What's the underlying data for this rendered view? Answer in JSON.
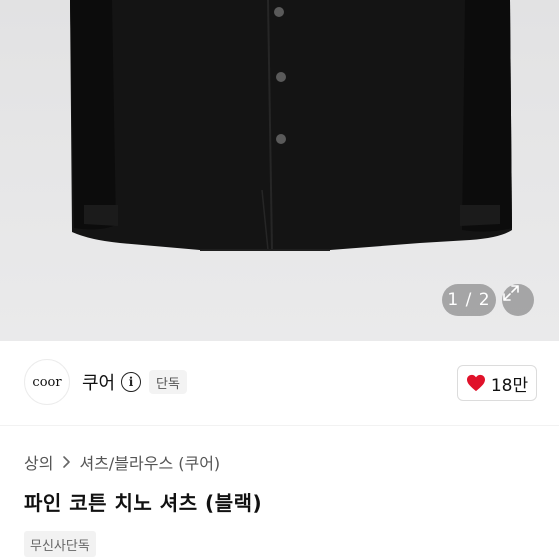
{
  "gallery": {
    "counter": "1 / 2",
    "expand_icon": "expand-icon"
  },
  "brand": {
    "logo_text": "coor",
    "name": "쿠어",
    "info_icon": "info-icon",
    "badge": "단독"
  },
  "like": {
    "icon": "heart-icon",
    "color": "#e0122a",
    "count": "18만"
  },
  "breadcrumb": {
    "category": "상의",
    "separator_icon": "chevron-right-icon",
    "subcategory": "셔츠/블라우스 (쿠어)"
  },
  "product": {
    "title": "파인 코튼 치노 셔츠 (블랙)",
    "tag": "무신사단독"
  }
}
